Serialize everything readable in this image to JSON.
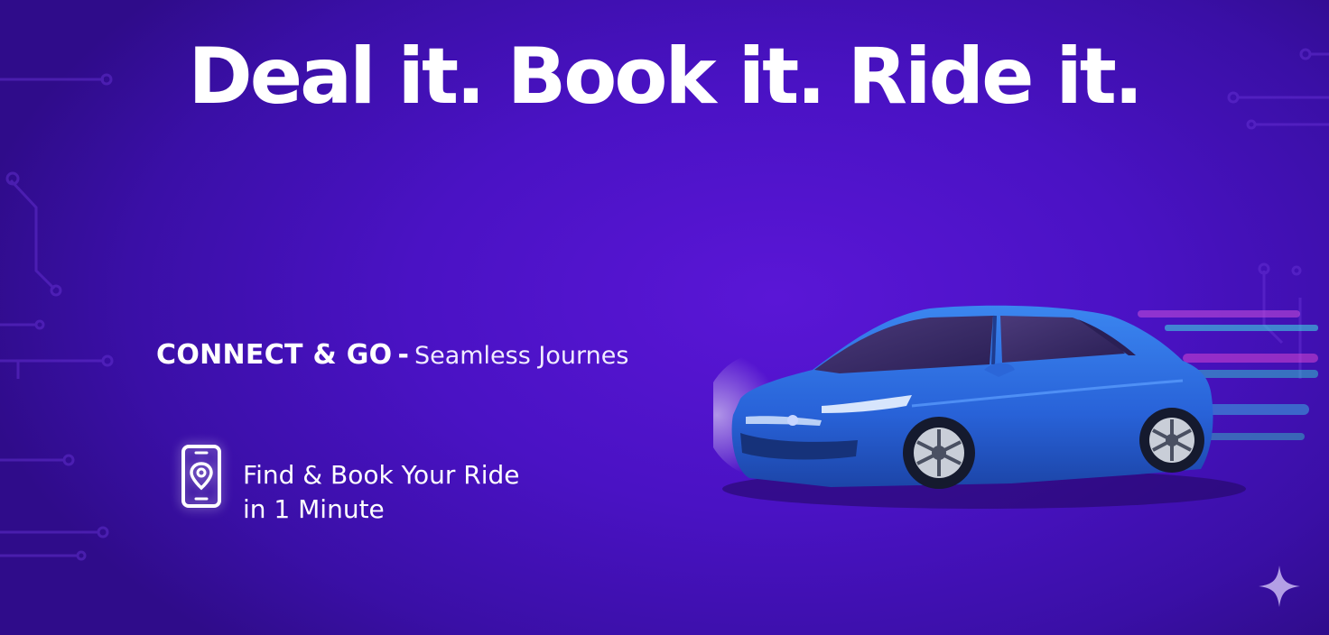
{
  "headline": "Deal it. Book it. Ride it.",
  "tagline": {
    "strong": "CONNECT & GO",
    "separator": "-",
    "light": "Seamless Journes"
  },
  "feature": {
    "icon": "phone-location-icon",
    "line1": "Find & Book Your Ride",
    "line2": "in 1 Minute"
  },
  "colors": {
    "background": "#4a12c4",
    "car_body": "#2f6fe0",
    "text": "#ffffff"
  }
}
